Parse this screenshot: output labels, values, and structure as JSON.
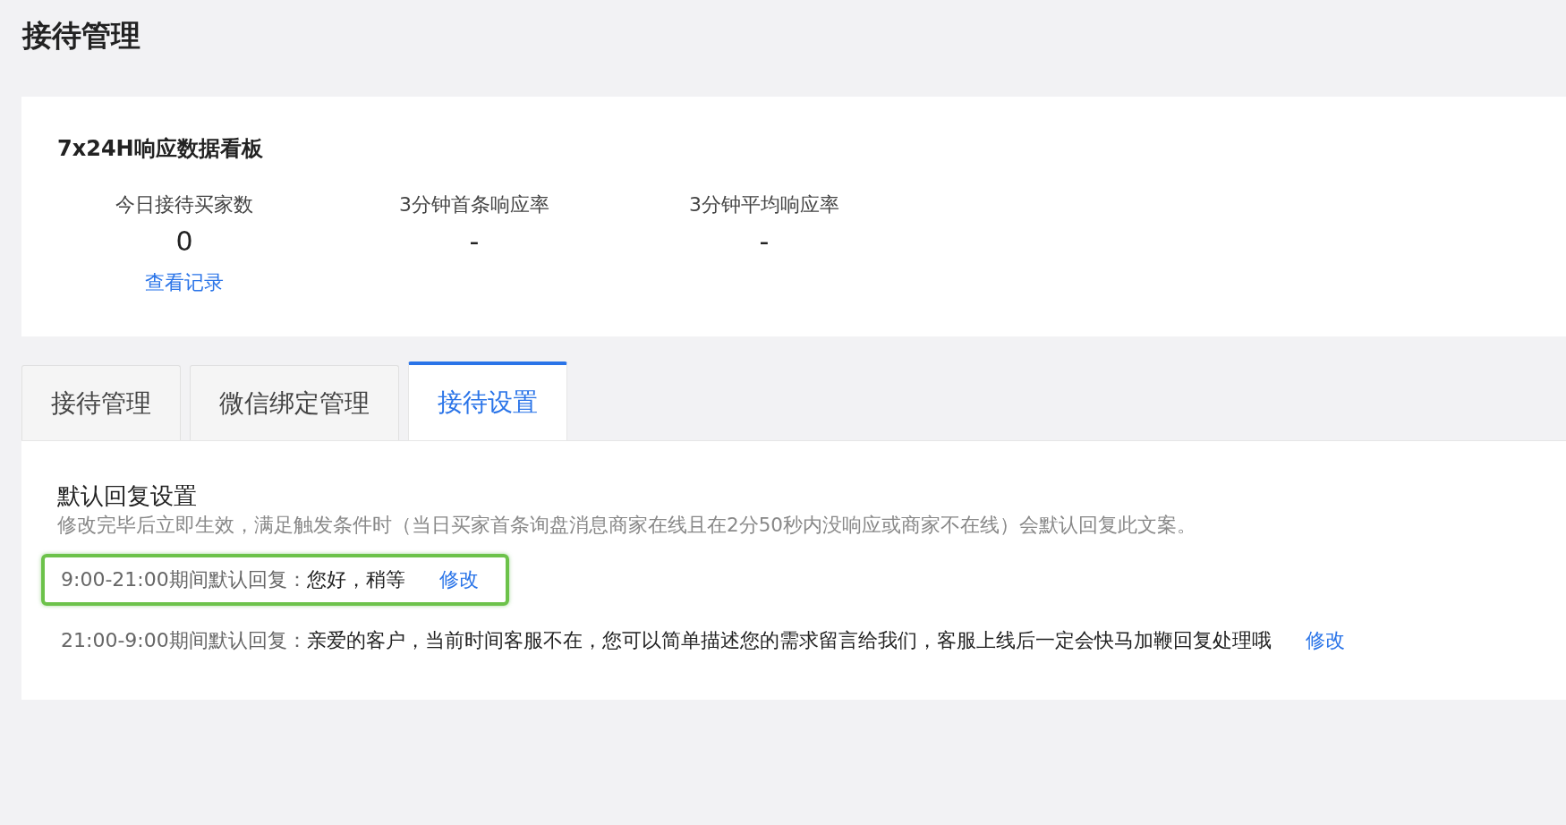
{
  "page_title": "接待管理",
  "dashboard": {
    "title": "7x24H响应数据看板",
    "stats": [
      {
        "label": "今日接待买家数",
        "value": "0",
        "link": "查看记录"
      },
      {
        "label": "3分钟首条响应率",
        "value": "-"
      },
      {
        "label": "3分钟平均响应率",
        "value": "-"
      }
    ]
  },
  "tabs": [
    {
      "label": "接待管理",
      "selected": false
    },
    {
      "label": "微信绑定管理",
      "selected": false
    },
    {
      "label": "接待设置",
      "selected": true
    }
  ],
  "settings": {
    "title": "默认回复设置",
    "description": "修改完毕后立即生效，满足触发条件时（当日买家首条询盘消息商家在线且在2分50秒内没响应或商家不在线）会默认回复此文案。",
    "replies": [
      {
        "label": "9:00-21:00期间默认回复：",
        "text": "您好，稍等",
        "action": "修改",
        "highlighted": true
      },
      {
        "label": "21:00-9:00期间默认回复：",
        "text": "亲爱的客户，当前时间客服不在，您可以简单描述您的需求留言给我们，客服上线后一定会快马加鞭回复处理哦",
        "action": "修改",
        "highlighted": false
      }
    ]
  }
}
